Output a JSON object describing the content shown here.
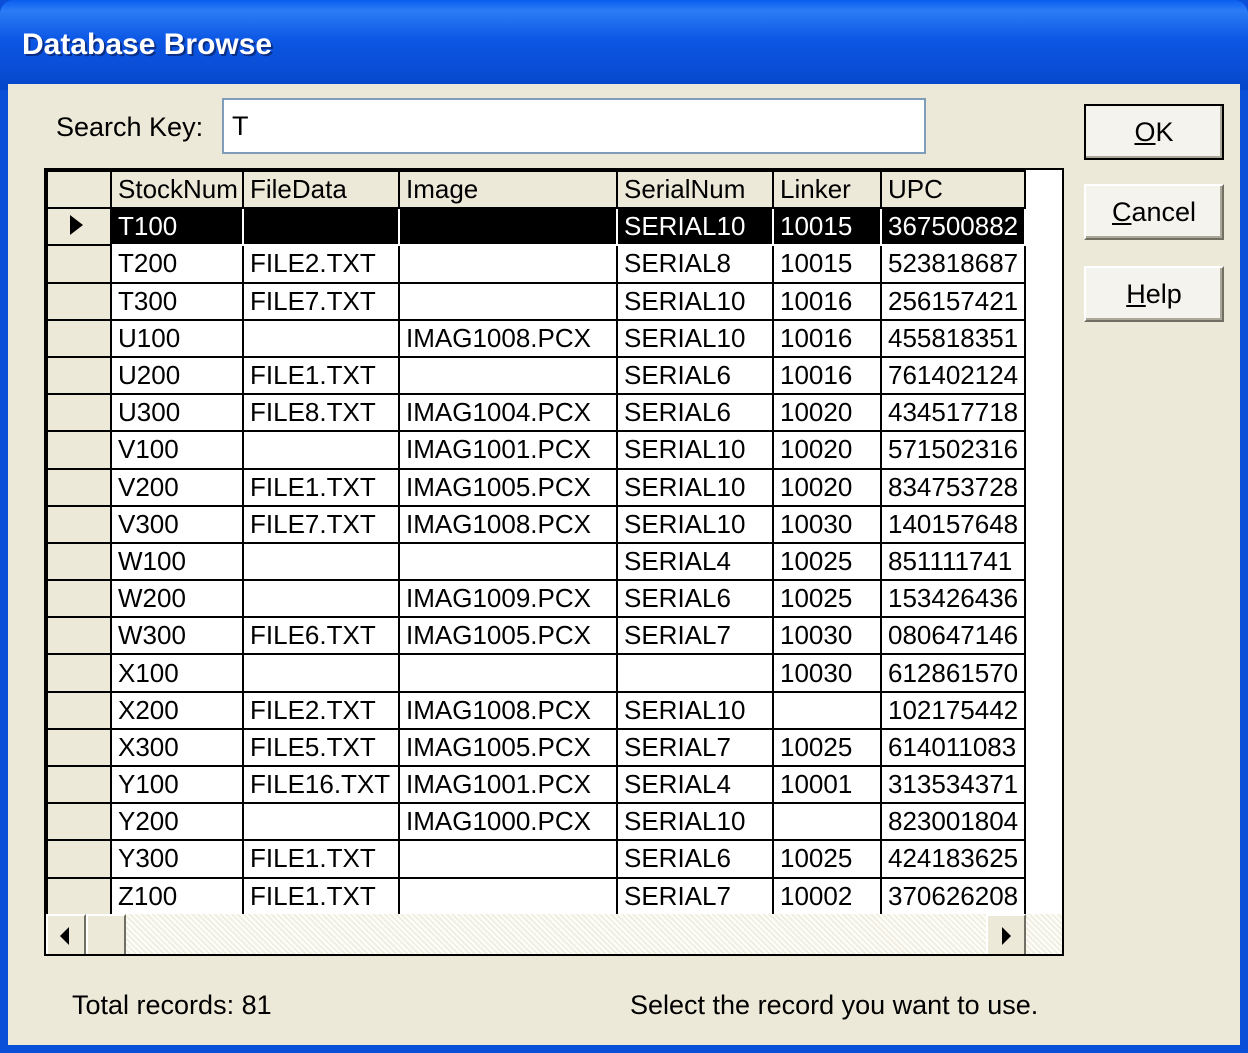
{
  "window": {
    "title": "Database Browse"
  },
  "search": {
    "label": "Search Key:",
    "value": "T"
  },
  "buttons": {
    "ok": "OK",
    "ok_key": "O",
    "ok_rest": "K",
    "cancel_key": "C",
    "cancel_rest": "ancel",
    "help_key": "H",
    "help_rest": "elp"
  },
  "grid": {
    "columns": [
      "StockNum",
      "FileData",
      "Image",
      "SerialNum",
      "Linker",
      "UPC"
    ],
    "rows": [
      [
        "T100",
        "",
        "",
        "SERIAL10",
        "10015",
        "367500882"
      ],
      [
        "T200",
        "FILE2.TXT",
        "",
        "SERIAL8",
        "10015",
        "523818687"
      ],
      [
        "T300",
        "FILE7.TXT",
        "",
        "SERIAL10",
        "10016",
        "256157421"
      ],
      [
        "U100",
        "",
        "IMAG1008.PCX",
        "SERIAL10",
        "10016",
        "455818351"
      ],
      [
        "U200",
        "FILE1.TXT",
        "",
        "SERIAL6",
        "10016",
        "761402124"
      ],
      [
        "U300",
        "FILE8.TXT",
        "IMAG1004.PCX",
        "SERIAL6",
        "10020",
        "434517718"
      ],
      [
        "V100",
        "",
        "IMAG1001.PCX",
        "SERIAL10",
        "10020",
        "571502316"
      ],
      [
        "V200",
        "FILE1.TXT",
        "IMAG1005.PCX",
        "SERIAL10",
        "10020",
        "834753728"
      ],
      [
        "V300",
        "FILE7.TXT",
        "IMAG1008.PCX",
        "SERIAL10",
        "10030",
        "140157648"
      ],
      [
        "W100",
        "",
        "",
        "SERIAL4",
        "10025",
        "851111741"
      ],
      [
        "W200",
        "",
        "IMAG1009.PCX",
        "SERIAL6",
        "10025",
        "153426436"
      ],
      [
        "W300",
        "FILE6.TXT",
        "IMAG1005.PCX",
        "SERIAL7",
        "10030",
        "080647146"
      ],
      [
        "X100",
        "",
        "",
        "",
        "10030",
        "612861570"
      ],
      [
        "X200",
        "FILE2.TXT",
        "IMAG1008.PCX",
        "SERIAL10",
        "",
        "102175442"
      ],
      [
        "X300",
        "FILE5.TXT",
        "IMAG1005.PCX",
        "SERIAL7",
        "10025",
        "614011083"
      ],
      [
        "Y100",
        "FILE16.TXT",
        "IMAG1001.PCX",
        "SERIAL4",
        "10001",
        "313534371"
      ],
      [
        "Y200",
        "",
        "IMAG1000.PCX",
        "SERIAL10",
        "",
        "823001804"
      ],
      [
        "Y300",
        "FILE1.TXT",
        "",
        "SERIAL6",
        "10025",
        "424183625"
      ],
      [
        "Z100",
        "FILE1.TXT",
        "",
        "SERIAL7",
        "10002",
        "370626208"
      ]
    ],
    "selected_row": 0
  },
  "status": {
    "total": "Total records: 81",
    "hint": "Select the record you want to use."
  }
}
